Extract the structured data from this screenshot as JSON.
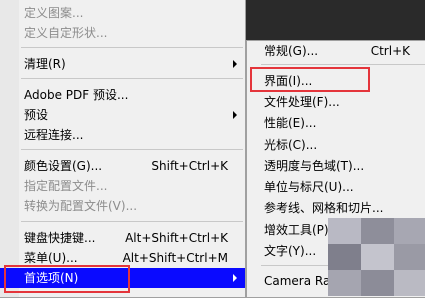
{
  "main_menu": {
    "items": [
      {
        "label": "定义图案...",
        "shortcut": "",
        "disabled": true
      },
      {
        "label": "定义自定形状...",
        "shortcut": "",
        "disabled": true
      },
      {
        "label": "清理(R)",
        "shortcut": "",
        "disabled": false,
        "submenu": true
      },
      {
        "label": "Adobe PDF 预设...",
        "shortcut": "",
        "disabled": false
      },
      {
        "label": "预设",
        "shortcut": "",
        "disabled": false,
        "submenu": true
      },
      {
        "label": "远程连接...",
        "shortcut": "",
        "disabled": false
      },
      {
        "label": "颜色设置(G)...",
        "shortcut": "Shift+Ctrl+K",
        "disabled": false
      },
      {
        "label": "指定配置文件...",
        "shortcut": "",
        "disabled": true
      },
      {
        "label": "转换为配置文件(V)...",
        "shortcut": "",
        "disabled": true
      },
      {
        "label": "键盘快捷键...",
        "shortcut": "Alt+Shift+Ctrl+K",
        "disabled": false
      },
      {
        "label": "菜单(U)...",
        "shortcut": "Alt+Shift+Ctrl+M",
        "disabled": false
      },
      {
        "label": "首选项(N)",
        "shortcut": "",
        "disabled": false,
        "submenu": true,
        "active": true
      }
    ]
  },
  "sub_menu": {
    "items": [
      {
        "label": "常规(G)...",
        "shortcut": "Ctrl+K"
      },
      {
        "label": "界面(I)...",
        "shortcut": ""
      },
      {
        "label": "文件处理(F)...",
        "shortcut": ""
      },
      {
        "label": "性能(E)...",
        "shortcut": ""
      },
      {
        "label": "光标(C)...",
        "shortcut": ""
      },
      {
        "label": "透明度与色域(T)...",
        "shortcut": ""
      },
      {
        "label": "单位与标尺(U)...",
        "shortcut": ""
      },
      {
        "label": "参考线、网格和切片...",
        "shortcut": ""
      },
      {
        "label": "增效工具(P)...",
        "shortcut": ""
      },
      {
        "label": "文字(Y)...",
        "shortcut": ""
      },
      {
        "label": "Camera Raw...",
        "shortcut": ""
      }
    ]
  },
  "colors": {
    "highlight_box": "#e4353b",
    "active_item": "#0a0aff",
    "menu_bg": "#f0f0f0"
  }
}
